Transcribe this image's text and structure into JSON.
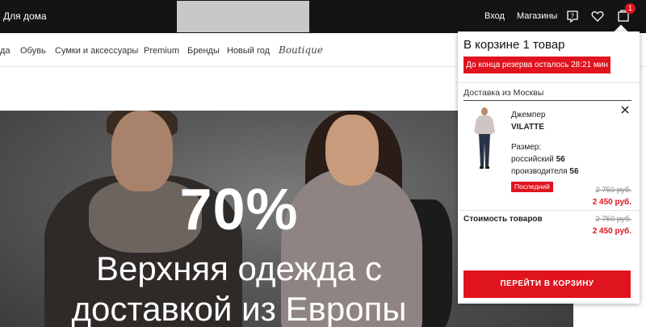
{
  "header": {
    "home_link": "Для дома",
    "login": "Вход",
    "stores": "Магазины",
    "cart_count": "1",
    "icons": [
      "help-icon",
      "heart-icon",
      "shopping-bag-icon"
    ]
  },
  "categories": [
    "да",
    "Обувь",
    "Сумки и аксессуары",
    "Premium",
    "Бренды",
    "Новый год",
    "Boutique"
  ],
  "hero": {
    "percent": "70%",
    "line1": "Верхняя одежда с",
    "line2": "доставкой из Европы"
  },
  "cart": {
    "title": "В корзине 1 товар",
    "reserve": "До конца резерва осталось 28:21 мин",
    "delivery": "Доставка из Москвы",
    "item": {
      "name": "Джемпер",
      "brand": "VILATTE",
      "size_label": "Размер:",
      "size_ru_label": "российский",
      "size_ru": "56",
      "size_mfr_label": "производителя",
      "size_mfr": "56",
      "badge": "Последний",
      "old_price": "2 750 руб.",
      "new_price": "2 450 руб."
    },
    "total_label": "Стоимость товаров",
    "total_old": "2 750 руб.",
    "total_new": "2 450 руб.",
    "button": "ПЕРЕЙТИ В КОРЗИНУ"
  },
  "colors": {
    "accent": "#e0141e",
    "topbar": "#141414"
  }
}
